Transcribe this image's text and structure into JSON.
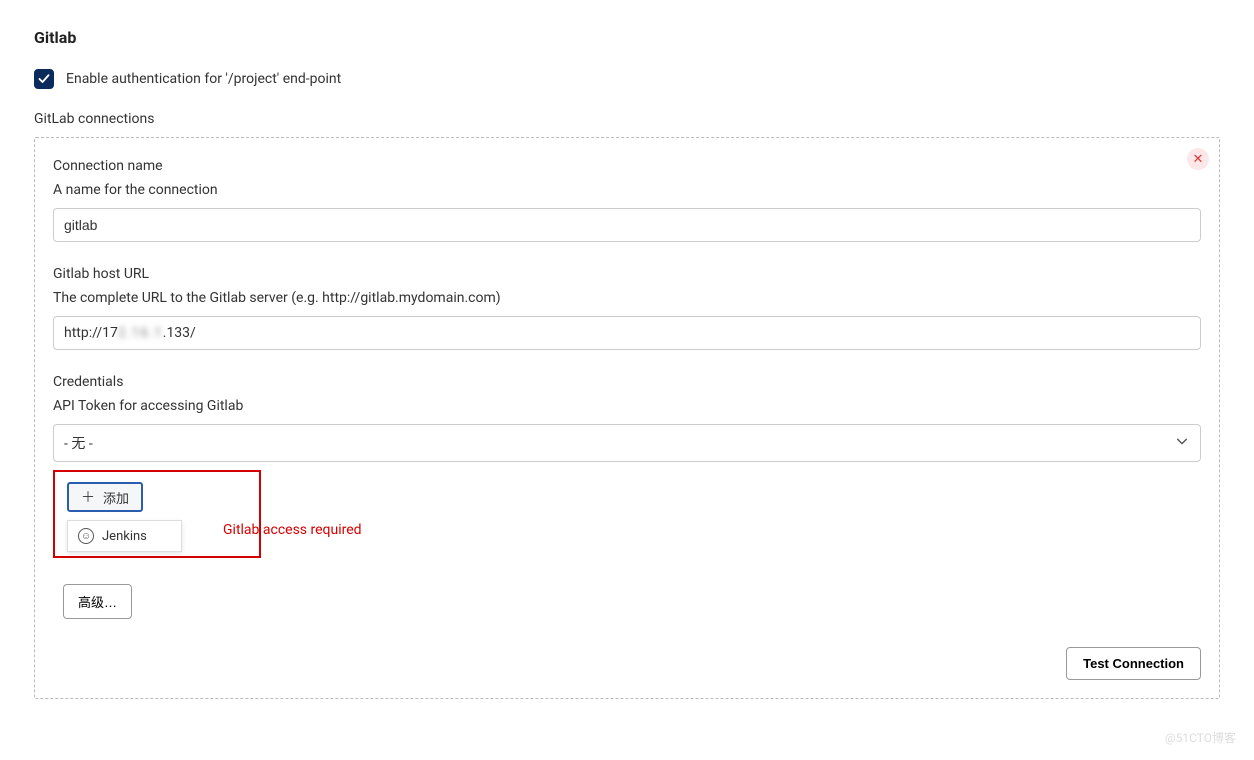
{
  "section": {
    "title": "Gitlab",
    "enable_auth_label": "Enable authentication for '/project' end-point",
    "enable_auth_checked": true,
    "connections_label": "GitLab connections"
  },
  "connection": {
    "name_label": "Connection name",
    "name_desc": "A name for the connection",
    "name_value": "gitlab",
    "host_label": "Gitlab host URL",
    "host_desc": "The complete URL to the Gitlab server (e.g. http://gitlab.mydomain.com)",
    "host_prefix": "http://17",
    "host_obscured": "2.16.1",
    "host_suffix": ".133/",
    "creds_label": "Credentials",
    "creds_desc": "API Token for accessing Gitlab",
    "creds_selected": "- 无 -",
    "add_label": "添加",
    "dropdown_option": "Jenkins",
    "error": "Gitlab access required",
    "advanced_label": "高级…",
    "test_label": "Test Connection"
  },
  "watermark": "@51CTO博客"
}
